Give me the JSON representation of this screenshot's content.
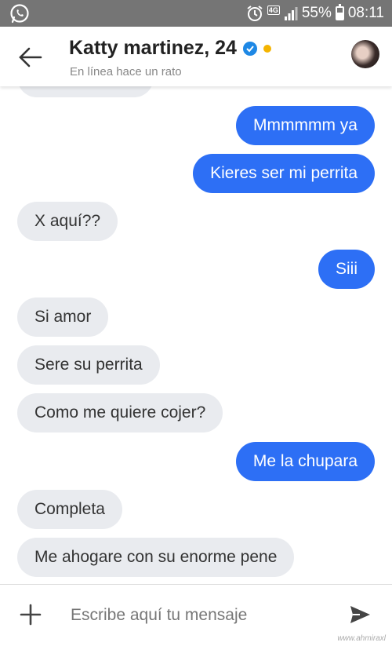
{
  "status_bar": {
    "app_icon": "whatsapp-icon",
    "alarm_icon": "alarm-icon",
    "network": "4G",
    "battery": "55%",
    "battery_level": 0.55,
    "time": "08:11"
  },
  "header": {
    "back_icon": "arrow-left-icon",
    "title": "Katty martinez, 24",
    "subtitle": "En línea hace un rato",
    "verified_color": "#1e88e5",
    "online_color": "#f4b400"
  },
  "messages": [
    {
      "side": "in",
      "text": ""
    },
    {
      "side": "out",
      "text": "Mmmmmm ya"
    },
    {
      "side": "out",
      "text": "Kieres ser mi perrita"
    },
    {
      "side": "in",
      "text": "X aquí??"
    },
    {
      "side": "out",
      "text": "Siii"
    },
    {
      "side": "in",
      "text": "Si amor"
    },
    {
      "side": "in",
      "text": "Sere su perrita"
    },
    {
      "side": "in",
      "text": "Como me quiere cojer?"
    },
    {
      "side": "out",
      "text": "Me la chupara"
    },
    {
      "side": "in",
      "text": "Completa"
    },
    {
      "side": "in",
      "text": "Me ahogare con su enorme pene"
    }
  ],
  "composer": {
    "placeholder": "Escribe aquí tu mensaje",
    "add_icon": "plus-icon",
    "send_icon": "send-icon"
  },
  "colors": {
    "outgoing_bubble": "#2d6ff5",
    "incoming_bubble": "#e9ebef"
  },
  "watermark": "www.ahmiraxl"
}
